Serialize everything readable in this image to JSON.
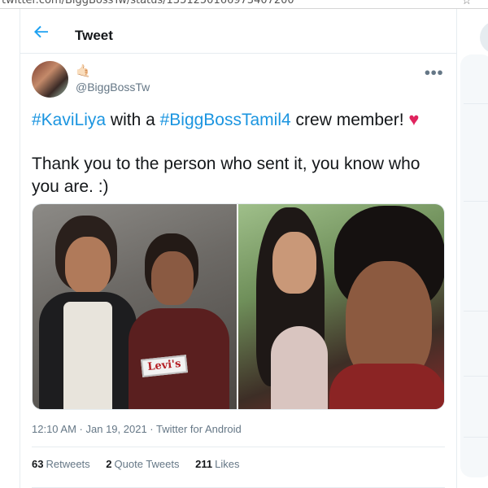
{
  "browser": {
    "url": "twitter.com/BiggBossTw/status/1351250166973407200"
  },
  "header": {
    "title": "Tweet"
  },
  "author": {
    "emoji": "🤙🏻",
    "handle": "@BiggBossTw"
  },
  "tweet": {
    "hashtag1": "#KaviLiya",
    "text1": " with a ",
    "hashtag2": "#BiggBossTamil4",
    "text2": " crew member! ",
    "heart": "♥",
    "line2": "Thank you to the person who sent it, you know who you are. :)",
    "image_text": "Levi's"
  },
  "meta": {
    "time": "12:10 AM",
    "separator": " · ",
    "date": "Jan 19, 2021",
    "source": "Twitter for Android"
  },
  "stats": {
    "retweets_count": "63",
    "retweets_label": "Retweets",
    "quotes_count": "2",
    "quotes_label": "Quote Tweets",
    "likes_count": "211",
    "likes_label": "Likes"
  },
  "icons": {
    "back": "arrow-left-icon",
    "more": "more-icon"
  },
  "colors": {
    "accent": "#1b95e0",
    "heart": "#e0245e",
    "muted": "#657786"
  }
}
